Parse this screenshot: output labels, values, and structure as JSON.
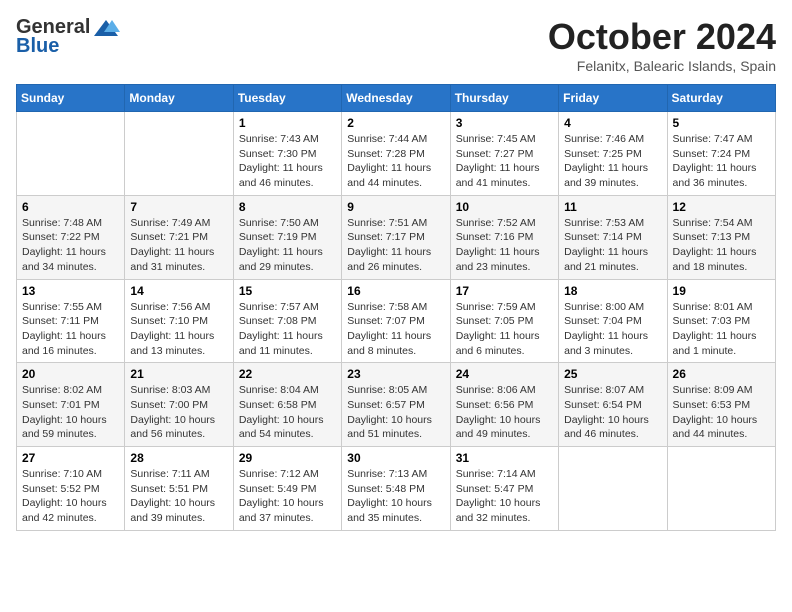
{
  "header": {
    "logo_general": "General",
    "logo_blue": "Blue",
    "month_title": "October 2024",
    "location": "Felanitx, Balearic Islands, Spain"
  },
  "weekdays": [
    "Sunday",
    "Monday",
    "Tuesday",
    "Wednesday",
    "Thursday",
    "Friday",
    "Saturday"
  ],
  "weeks": [
    [
      {
        "day": "",
        "info": ""
      },
      {
        "day": "",
        "info": ""
      },
      {
        "day": "1",
        "info": "Sunrise: 7:43 AM\nSunset: 7:30 PM\nDaylight: 11 hours and 46 minutes."
      },
      {
        "day": "2",
        "info": "Sunrise: 7:44 AM\nSunset: 7:28 PM\nDaylight: 11 hours and 44 minutes."
      },
      {
        "day": "3",
        "info": "Sunrise: 7:45 AM\nSunset: 7:27 PM\nDaylight: 11 hours and 41 minutes."
      },
      {
        "day": "4",
        "info": "Sunrise: 7:46 AM\nSunset: 7:25 PM\nDaylight: 11 hours and 39 minutes."
      },
      {
        "day": "5",
        "info": "Sunrise: 7:47 AM\nSunset: 7:24 PM\nDaylight: 11 hours and 36 minutes."
      }
    ],
    [
      {
        "day": "6",
        "info": "Sunrise: 7:48 AM\nSunset: 7:22 PM\nDaylight: 11 hours and 34 minutes."
      },
      {
        "day": "7",
        "info": "Sunrise: 7:49 AM\nSunset: 7:21 PM\nDaylight: 11 hours and 31 minutes."
      },
      {
        "day": "8",
        "info": "Sunrise: 7:50 AM\nSunset: 7:19 PM\nDaylight: 11 hours and 29 minutes."
      },
      {
        "day": "9",
        "info": "Sunrise: 7:51 AM\nSunset: 7:17 PM\nDaylight: 11 hours and 26 minutes."
      },
      {
        "day": "10",
        "info": "Sunrise: 7:52 AM\nSunset: 7:16 PM\nDaylight: 11 hours and 23 minutes."
      },
      {
        "day": "11",
        "info": "Sunrise: 7:53 AM\nSunset: 7:14 PM\nDaylight: 11 hours and 21 minutes."
      },
      {
        "day": "12",
        "info": "Sunrise: 7:54 AM\nSunset: 7:13 PM\nDaylight: 11 hours and 18 minutes."
      }
    ],
    [
      {
        "day": "13",
        "info": "Sunrise: 7:55 AM\nSunset: 7:11 PM\nDaylight: 11 hours and 16 minutes."
      },
      {
        "day": "14",
        "info": "Sunrise: 7:56 AM\nSunset: 7:10 PM\nDaylight: 11 hours and 13 minutes."
      },
      {
        "day": "15",
        "info": "Sunrise: 7:57 AM\nSunset: 7:08 PM\nDaylight: 11 hours and 11 minutes."
      },
      {
        "day": "16",
        "info": "Sunrise: 7:58 AM\nSunset: 7:07 PM\nDaylight: 11 hours and 8 minutes."
      },
      {
        "day": "17",
        "info": "Sunrise: 7:59 AM\nSunset: 7:05 PM\nDaylight: 11 hours and 6 minutes."
      },
      {
        "day": "18",
        "info": "Sunrise: 8:00 AM\nSunset: 7:04 PM\nDaylight: 11 hours and 3 minutes."
      },
      {
        "day": "19",
        "info": "Sunrise: 8:01 AM\nSunset: 7:03 PM\nDaylight: 11 hours and 1 minute."
      }
    ],
    [
      {
        "day": "20",
        "info": "Sunrise: 8:02 AM\nSunset: 7:01 PM\nDaylight: 10 hours and 59 minutes."
      },
      {
        "day": "21",
        "info": "Sunrise: 8:03 AM\nSunset: 7:00 PM\nDaylight: 10 hours and 56 minutes."
      },
      {
        "day": "22",
        "info": "Sunrise: 8:04 AM\nSunset: 6:58 PM\nDaylight: 10 hours and 54 minutes."
      },
      {
        "day": "23",
        "info": "Sunrise: 8:05 AM\nSunset: 6:57 PM\nDaylight: 10 hours and 51 minutes."
      },
      {
        "day": "24",
        "info": "Sunrise: 8:06 AM\nSunset: 6:56 PM\nDaylight: 10 hours and 49 minutes."
      },
      {
        "day": "25",
        "info": "Sunrise: 8:07 AM\nSunset: 6:54 PM\nDaylight: 10 hours and 46 minutes."
      },
      {
        "day": "26",
        "info": "Sunrise: 8:09 AM\nSunset: 6:53 PM\nDaylight: 10 hours and 44 minutes."
      }
    ],
    [
      {
        "day": "27",
        "info": "Sunrise: 7:10 AM\nSunset: 5:52 PM\nDaylight: 10 hours and 42 minutes."
      },
      {
        "day": "28",
        "info": "Sunrise: 7:11 AM\nSunset: 5:51 PM\nDaylight: 10 hours and 39 minutes."
      },
      {
        "day": "29",
        "info": "Sunrise: 7:12 AM\nSunset: 5:49 PM\nDaylight: 10 hours and 37 minutes."
      },
      {
        "day": "30",
        "info": "Sunrise: 7:13 AM\nSunset: 5:48 PM\nDaylight: 10 hours and 35 minutes."
      },
      {
        "day": "31",
        "info": "Sunrise: 7:14 AM\nSunset: 5:47 PM\nDaylight: 10 hours and 32 minutes."
      },
      {
        "day": "",
        "info": ""
      },
      {
        "day": "",
        "info": ""
      }
    ]
  ]
}
